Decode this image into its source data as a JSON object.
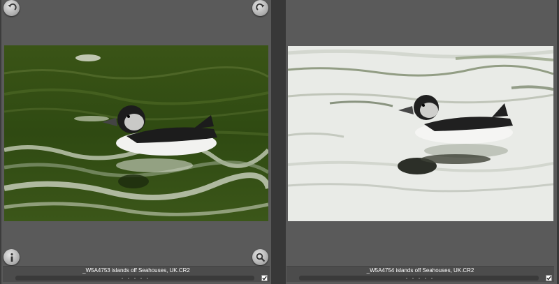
{
  "panels": [
    {
      "filename": "_W5A4753 islands off Seahouses, UK.CR2",
      "photo_theme": "puffin-on-green-water",
      "checked": true,
      "rating_dots": 5
    },
    {
      "filename": "_W5A4754 islands off Seahouses, UK.CR2",
      "photo_theme": "puffin-on-white-water",
      "checked": true,
      "rating_dots": 5
    }
  ],
  "icons": {
    "rotate_left": "rotate-left-icon",
    "rotate_right": "rotate-right-icon",
    "info": "info-icon",
    "zoom": "magnifier-icon",
    "check": "checkmark-icon"
  },
  "colors": {
    "panel_bg": "#5a5a5a",
    "gutter_bg": "#383838",
    "caption_text": "#ffffff",
    "green_water": "#3f5a1a"
  }
}
